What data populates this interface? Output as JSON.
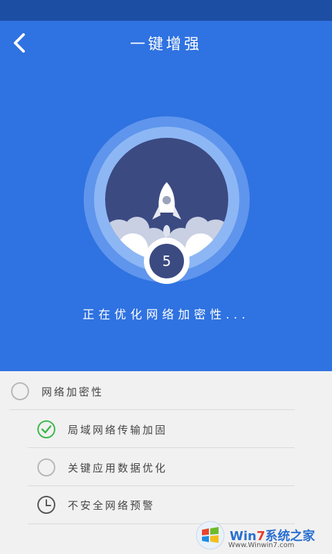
{
  "header": {
    "title": "一键增强",
    "back_icon": "chevron-left-icon"
  },
  "hero": {
    "countdown": "5",
    "status": "正在优化网络加密性..."
  },
  "list": {
    "section_title": "网络加密性",
    "items": [
      {
        "label": "局域网络传输加固",
        "icon": "check-circle-icon",
        "state": "done"
      },
      {
        "label": "关键应用数据优化",
        "icon": "loading-circle-icon",
        "state": "pending"
      },
      {
        "label": "不安全网络预警",
        "icon": "clock-icon",
        "state": "waiting"
      }
    ]
  },
  "watermark": {
    "brand_win": "Win",
    "brand_seven": "7",
    "brand_rest": "系统之家",
    "url": "Www.Winwin7.com"
  },
  "colors": {
    "hero_bg": "#2f72e1",
    "status_bar": "#1c4ea3",
    "check_green": "#3cb84a"
  }
}
